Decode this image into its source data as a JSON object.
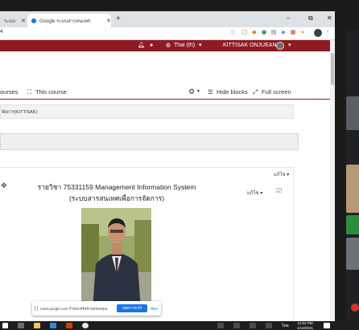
{
  "browser": {
    "tabs": [
      {
        "label": "ระบบสารสนเทศ"
      },
      {
        "label": "Google ระบบสารสนเทศ"
      }
    ],
    "new_tab": "+",
    "url_fragment": "4",
    "window_controls": {
      "minimize": "–",
      "restore": "⧉",
      "close": "✕"
    }
  },
  "navbar": {
    "language": "Thai (th)",
    "user_name": "KITTISAK ONJUEAN"
  },
  "nav": {
    "courses_link": "ourses",
    "this_course": "This course",
    "hide_blocks": "Hide blocks",
    "full_screen": "Full screen"
  },
  "breadcrumb": "จัดการ(KITTISAK)",
  "content": {
    "edit_top": "แก้ไข ▾",
    "edit_mid": "แก้ไข ▾",
    "course_title_line1": "รายวิชา 75331159 Management Information System",
    "course_title_line2": "(ระบบสารสนเทศเพื่อการจัดการ)"
  },
  "sharebar": {
    "text": "meet.google.com กำลังแชร์หน้าจอของคุณ",
    "stop": "หยุดการแชร์",
    "hide": "ซ่อน"
  },
  "taskbar": {
    "language": "ไทย",
    "time": "12:04 PM",
    "date": "1/14/2021"
  },
  "colors": {
    "brand": "#8e1a22",
    "accent_blue": "#1a73e8"
  }
}
